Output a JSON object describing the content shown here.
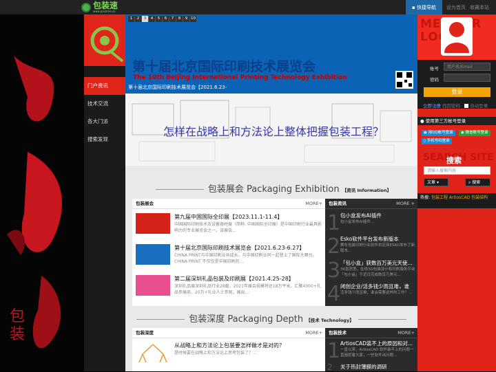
{
  "topbar": {
    "logo_text": "包装速",
    "logo_sub": "www.packme.cn",
    "quick_nav": "快捷导航",
    "links": [
      "设为首页",
      "收藏本站"
    ]
  },
  "left_art": {
    "vertical_text": "包装"
  },
  "nav": {
    "items": [
      {
        "label": "门户资讯",
        "active": true
      },
      {
        "label": "技术交流",
        "active": false
      },
      {
        "label": "各大门派",
        "active": false
      },
      {
        "label": "搜索发现",
        "active": false
      }
    ]
  },
  "banner": {
    "pager": [
      "1",
      "2",
      "3",
      "4",
      "5",
      "6",
      "7",
      "8",
      "9",
      "10"
    ],
    "active_page": "3",
    "title_cn": "第十届北京国际印刷技术展览会",
    "title_en": "The 10th Beijing International Printing Technology Exhibition",
    "caption": "第十届北京国际印刷技术展览会【2021.6.23-",
    "question": "怎样在战略上和方法论上整体把握包装工程？"
  },
  "section1": {
    "title": "包装展会 Packaging Exhibition",
    "tag": "【资讯 Information】",
    "left_panel": {
      "header": "包装展会",
      "more": "MORE+",
      "items": [
        {
          "title": "第九届中国国际全印展【2023.11.1-11.4】",
          "desc": "中国国际印刷技术及设备器材展（简称: 中国国际全印展）是中国印刷行业最具影响力的专业展览会之一。该展会...",
          "thumb_color": "#d5221a"
        },
        {
          "title": "第十届北京国际印刷技术展览会【2021.6.23-6.27】",
          "desc": "CHINA PRINT与中国印刷业共成长，与中国印刷业同一起登上了国际大舞台。CHINA PRINT 不仅仅是中国印刷的...",
          "thumb_color": "#1a6ec0"
        },
        {
          "title": "第二届深圳礼品包装及印刷展【2021.4.25-28】",
          "desc": "深圳礼品展深圳礼品行业28载，2021年展会规模将达18万平米，汇聚4000+礼品参展商，20万+礼业人士参观，展出...",
          "thumb_color": "#e94e8f"
        }
      ]
    },
    "right_panel": {
      "header": "包装资讯",
      "more": "MORE +",
      "items": [
        {
          "num": "1",
          "title": "包小盒发布AI插件",
          "desc": "包小盒发布AI插件..."
        },
        {
          "num": "2",
          "title": "Esko软件平台发布新版本",
          "desc": "赛车包装印刷行业软件供应商ESKO发布了新版本..."
        },
        {
          "num": "3",
          "title": "「包小盒」获数百万美元天使...",
          "desc": "36氪获悉，在线3D包装设计和印刷服务平台「包小盒」于近日完成数百万美元..."
        },
        {
          "num": "4",
          "title": "闭创企业/活多钱少而且难，谁",
          "desc": "活多钱少而且难，谁会需要这样的工作？..."
        }
      ]
    }
  },
  "section2": {
    "title": "包装深度 Packaging Depth",
    "tag": "【技术 Technology】",
    "left_panel": {
      "header": "包装深度",
      "more": "MORE+",
      "items": [
        {
          "title": "从战略上和方法论上包装要怎样做才是对的？",
          "desc": "是时候要在战略上和方法论上思考包装了？..."
        }
      ]
    },
    "right_panel": {
      "header": "包装技术",
      "more": "MORE+",
      "items": [
        {
          "num": "1",
          "title": "ArtiosCAD装不上的原因和对...",
          "desc": "一直以来，ArtiosCAD 软件装不上的问题一直困扰着大家，一些软件出问题..."
        },
        {
          "num": "2",
          "title": "关于热封薄膜的调研",
          "desc": ""
        }
      ]
    }
  },
  "right": {
    "member_text": "MEMBER LOGIN",
    "account_label": "账号",
    "account_placeholder": "用户名/Email",
    "password_label": "密码",
    "login_button": "登录",
    "quick_register": "立即注册",
    "forgot": "找回密码",
    "auto_login": "自动登录",
    "third_party_header": "使用第三方帐号登录",
    "qq_login": "用QQ帐号登录",
    "wechat_login": "微信账号登录",
    "phone_login": "手机号码登录",
    "search_title": "搜索",
    "search_bg": "SEARCH SITE",
    "search_placeholder": "请输入搜索内容",
    "search_select": "文章",
    "search_button": "搜索",
    "hot_label": "热搜:",
    "hot_tags": [
      "包装工程",
      "ArtiosCAD",
      "包装结构"
    ]
  },
  "colors": {
    "accent_red": "#e0241a",
    "login_orange": "#f5a500",
    "brand_green": "#4caf50",
    "nav_blue": "#1e6aa8"
  }
}
